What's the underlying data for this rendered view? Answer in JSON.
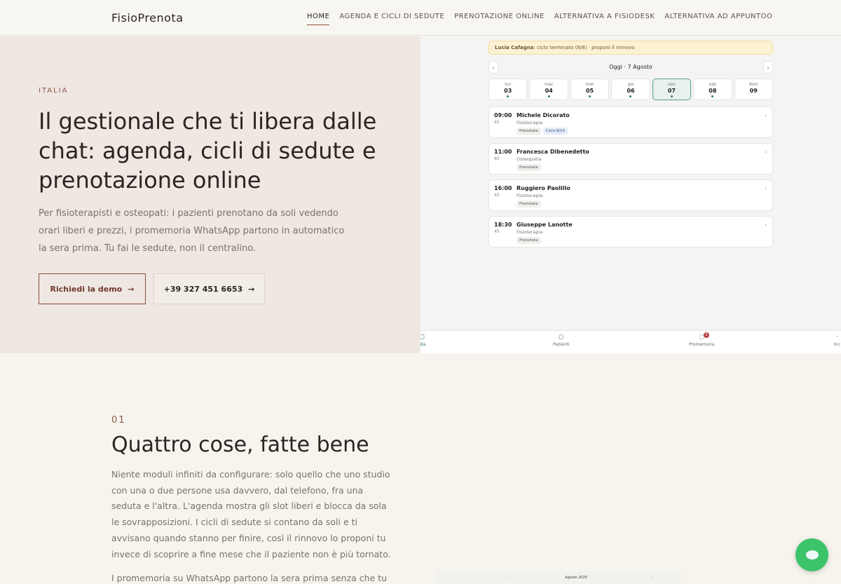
{
  "header": {
    "brand": "FisioPrenota",
    "nav": [
      {
        "label": "HOME",
        "active": true
      },
      {
        "label": "AGENDA E CICLI DI SEDUTE"
      },
      {
        "label": "PRENOTAZIONE ONLINE"
      },
      {
        "label": "ALTERNATIVA A FISIODESK"
      },
      {
        "label": "ALTERNATIVA AD APPUNTOO"
      }
    ]
  },
  "hero": {
    "kicker": "ITALIA",
    "title": "Il gestionale che ti libera dalle chat: agenda, cicli di sedute e prenotazione online",
    "subtitle": "Per fisioterapisti e osteopati: i pazienti prenotano da soli vedendo orari liberi e prezzi, i promemoria WhatsApp partono in automatico la sera prima. Tu fai le sedute, non il centralino.",
    "cta_primary": "Richiedi la demo",
    "cta_secondary": "+39 327 451 6653",
    "arrow": "→"
  },
  "app": {
    "banner_name": "Lucia Cafagna",
    "banner_text": ": ciclo terminato (8/8) · proponi il rinnovo",
    "cal_title": "Oggi · 7 Agosto",
    "prev": "‹",
    "next": "›",
    "days": [
      {
        "name": "lun",
        "num": "03"
      },
      {
        "name": "mar",
        "num": "04"
      },
      {
        "name": "mer",
        "num": "05"
      },
      {
        "name": "gio",
        "num": "06"
      },
      {
        "name": "ven",
        "num": "07"
      },
      {
        "name": "sab",
        "num": "08"
      },
      {
        "name": "dom",
        "num": "09"
      }
    ],
    "appointments": [
      {
        "time": "09:00",
        "duration": "45",
        "name": "Michele Dicorato",
        "service": "Fisioterapia",
        "tags": [
          "Prenotata",
          "Ciclo 8/10"
        ]
      },
      {
        "time": "11:00",
        "duration": "60",
        "name": "Francesca Dibenedetto",
        "service": "Osteopatia",
        "tags": [
          "Prenotata"
        ]
      },
      {
        "time": "16:00",
        "duration": "45",
        "name": "Ruggiero Paolillo",
        "service": "Fisioterapia",
        "tags": [
          "Prenotata"
        ]
      },
      {
        "time": "18:30",
        "duration": "45",
        "name": "Giuseppe Lanotte",
        "service": "Fisioterapia",
        "tags": [
          "Prenotata"
        ]
      }
    ],
    "chevron": "›",
    "bottom_nav": {
      "agenda": "nda",
      "patients": "Pazienti",
      "reminders": "Promemoria",
      "reminders_badge": "3",
      "more": "Inc"
    }
  },
  "section1": {
    "number": "01",
    "title": "Quattro cose, fatte bene",
    "body": "Niente moduli infiniti da configurare: solo quello che uno studio con una o due persone usa davvero, dal telefono, fra una seduta e l'altra. L'agenda mostra gli slot liberi e blocca da sola le sovrapposizioni. I cicli di sedute si contano da soli e ti avvisano quando stanno per finire, così il rinnovo lo proponi tu invece di scoprire a fine mese che il paziente non è più tornato.",
    "body2": "I promemoria su WhatsApp partono la sera prima senza che tu faccia"
  },
  "mini_preview": {
    "title": "Agosto 2026"
  },
  "colors": {
    "accent": "#8a4a3a",
    "hero_bg": "#efe7e1",
    "page_bg": "#f7f4ee",
    "whatsapp": "#3cc46b",
    "app_green": "#2e7d64"
  }
}
